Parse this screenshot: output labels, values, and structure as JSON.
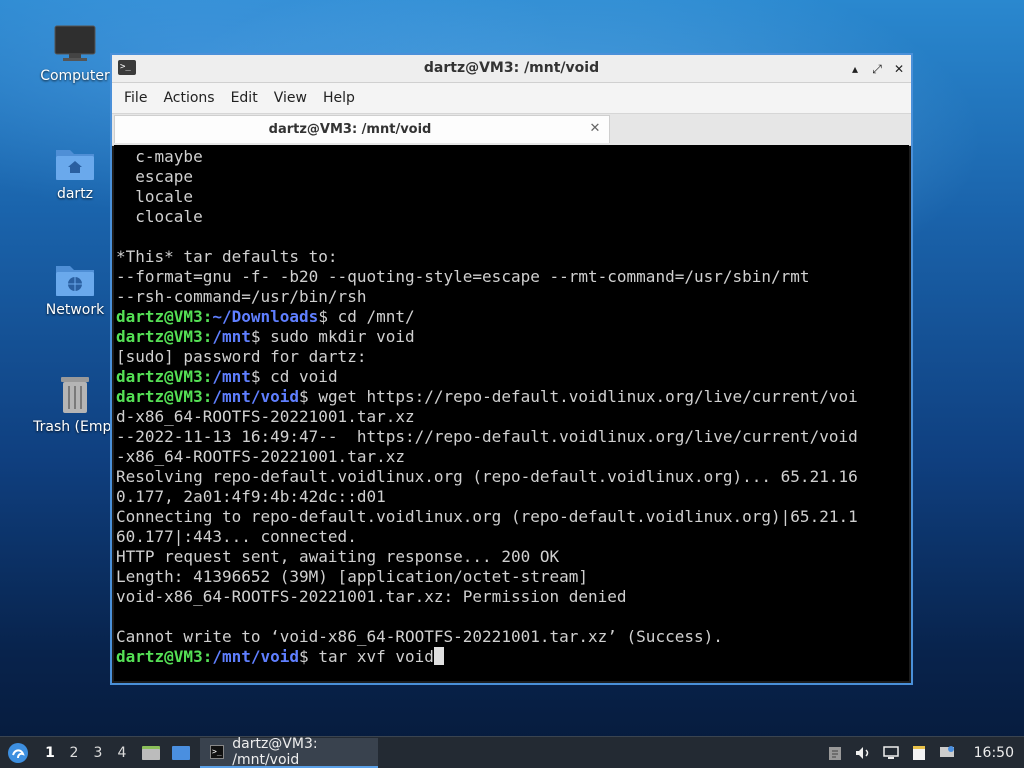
{
  "desktop": {
    "icons": [
      {
        "label": "Computer"
      },
      {
        "label": "dartz"
      },
      {
        "label": "Network"
      },
      {
        "label": "Trash (Empt"
      }
    ]
  },
  "window": {
    "title": "dartz@VM3: /mnt/void",
    "controls": {
      "minimize": "▴",
      "maximize": "⤢",
      "close": "✕"
    },
    "menu": [
      "File",
      "Actions",
      "Edit",
      "View",
      "Help"
    ],
    "tab": {
      "label": "dartz@VM3: /mnt/void",
      "close": "✕"
    }
  },
  "terminal": {
    "lines": [
      {
        "text": "  c-maybe"
      },
      {
        "text": "  escape"
      },
      {
        "text": "  locale"
      },
      {
        "text": "  clocale"
      },
      {
        "text": ""
      },
      {
        "text": "*This* tar defaults to:"
      },
      {
        "text": "--format=gnu -f- -b20 --quoting-style=escape --rmt-command=/usr/sbin/rmt"
      },
      {
        "text": "--rsh-command=/usr/bin/rsh"
      },
      {
        "prompt": {
          "user": "dartz@VM3",
          "path": "~/Downloads",
          "cmd": "$ cd /mnt/"
        }
      },
      {
        "prompt": {
          "user": "dartz@VM3",
          "path": "/mnt",
          "cmd": "$ sudo mkdir void"
        }
      },
      {
        "text": "[sudo] password for dartz:"
      },
      {
        "prompt": {
          "user": "dartz@VM3",
          "path": "/mnt",
          "cmd": "$ cd void"
        }
      },
      {
        "prompt": {
          "user": "dartz@VM3",
          "path": "/mnt/void",
          "cmd": "$ wget https://repo-default.voidlinux.org/live/current/voi"
        }
      },
      {
        "text": "d-x86_64-ROOTFS-20221001.tar.xz"
      },
      {
        "text": "--2022-11-13 16:49:47--  https://repo-default.voidlinux.org/live/current/void"
      },
      {
        "text": "-x86_64-ROOTFS-20221001.tar.xz"
      },
      {
        "text": "Resolving repo-default.voidlinux.org (repo-default.voidlinux.org)... 65.21.16"
      },
      {
        "text": "0.177, 2a01:4f9:4b:42dc::d01"
      },
      {
        "text": "Connecting to repo-default.voidlinux.org (repo-default.voidlinux.org)|65.21.1"
      },
      {
        "text": "60.177|:443... connected."
      },
      {
        "text": "HTTP request sent, awaiting response... 200 OK"
      },
      {
        "text": "Length: 41396652 (39M) [application/octet-stream]"
      },
      {
        "text": "void-x86_64-ROOTFS-20221001.tar.xz: Permission denied"
      },
      {
        "text": ""
      },
      {
        "text": "Cannot write to ‘void-x86_64-ROOTFS-20221001.tar.xz’ (Success)."
      },
      {
        "prompt": {
          "user": "dartz@VM3",
          "path": "/mnt/void",
          "cmd": "$ tar xvf void"
        },
        "cursor": true
      }
    ]
  },
  "taskbar": {
    "workspaces": [
      "1",
      "2",
      "3",
      "4"
    ],
    "active_workspace": "1",
    "task": {
      "label": "dartz@VM3: /mnt/void"
    },
    "clock": "16:50"
  },
  "colors": {
    "prompt_user": "#55e055",
    "prompt_path": "#5f7fff",
    "window_border": "#4a90d9"
  }
}
